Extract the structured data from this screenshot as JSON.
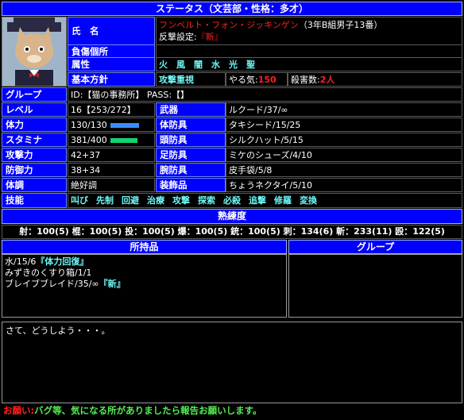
{
  "header": {
    "title": "ステータス（文芸部・性格：多才）"
  },
  "profile": {
    "name_label": "氏　名",
    "name": "フンベルト・フォン・ジッキンゲン",
    "name_detail": "（3年B組男子13番）",
    "counter_prefix": "反撃設定:",
    "counter_value": "『新』",
    "injury_label": "負傷個所",
    "injury_value": "",
    "attribute_label": "属性",
    "attributes": "火　風　闇　水　光　聖",
    "policy_label": "基本方針",
    "policy_value": "攻撃重視",
    "motivation_label": "やる気:",
    "motivation_value": "150",
    "kills_label": "殺害数:",
    "kills_value": "2人",
    "avatar_icon": "cat-gentleman-portrait-icon"
  },
  "group": {
    "label": "グループ",
    "value": "ID:【猫の事務所】 PASS:【】"
  },
  "stats": {
    "level_label": "レベル",
    "level_value": "16【253/272】",
    "hp_label": "体力",
    "hp_value": "130/130",
    "hp_fill": 1.0,
    "stamina_label": "スタミナ",
    "stamina_value": "381/400",
    "stamina_fill": 0.95,
    "attack_label": "攻撃力",
    "attack_value": "42+37",
    "defense_label": "防御力",
    "defense_value": "38+34",
    "condition_label": "体調",
    "condition_value": "絶好調"
  },
  "equipment": {
    "weapon_label": "武器",
    "weapon_value": "ルクード/37/∞",
    "body_label": "体防具",
    "body_value": "タキシード/15/25",
    "head_label": "頭防具",
    "head_value": "シルクハット/5/15",
    "foot_label": "足防具",
    "foot_value": "ミケのシューズ/4/10",
    "arm_label": "腕防具",
    "arm_value": "皮手袋/5/8",
    "accessory_label": "装飾品",
    "accessory_value": "ちょうネクタイ/5/10"
  },
  "skills": {
    "label": "技能",
    "items": [
      "叫び",
      "先制",
      "回避",
      "治療",
      "攻撃",
      "探索",
      "必殺",
      "追撃",
      "修羅",
      "変換"
    ]
  },
  "proficiency": {
    "title": "熟練度",
    "text": "射：100(5) 棍：100(5) 投：100(5) 爆：100(5) 銃：100(5) 刺：134(6) 斬：233(11) 殴：122(5)"
  },
  "inventory": {
    "title": "所持品",
    "items": [
      {
        "text": "水/15/6",
        "tag": "『体力回復』"
      },
      {
        "text": "みずきのくすり箱/1/1",
        "tag": ""
      },
      {
        "text": "ブレイブブレイド/35/∞",
        "tag": "『新』"
      }
    ]
  },
  "group_panel": {
    "title": "グループ"
  },
  "message": {
    "text": "さて、どうしよう・・・。"
  },
  "notice": {
    "prefix": "お願い:",
    "text": "バグ等、気になる所がありましたら報告お願いします。"
  },
  "colors": {
    "label_bg": "#0000ff",
    "accent_cyan": "#6ff6f6",
    "hp_bar": "#3a8bff",
    "stamina_bar": "#12d46f",
    "warning_red": "#ff2020",
    "notice_green": "#55ee55"
  }
}
